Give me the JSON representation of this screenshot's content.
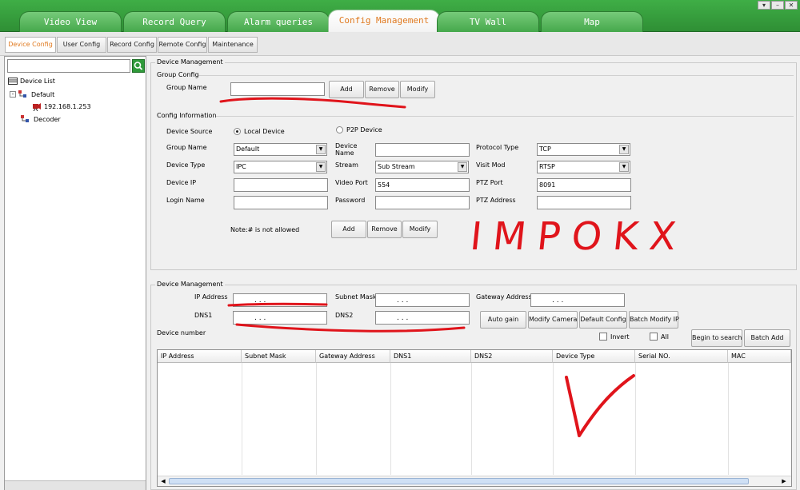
{
  "top_tabs": [
    "Video View",
    "Record Query",
    "Alarm queries",
    "Config Management",
    "TV Wall",
    "Map"
  ],
  "window_controls": [
    "▾",
    "–",
    "✕"
  ],
  "sub_tabs": [
    "Device Config",
    "User Config",
    "Record Config",
    "Remote Config",
    "Maintenance"
  ],
  "left": {
    "search_placeholder": "",
    "tree": {
      "root": "Device List",
      "group": "Default",
      "device": "192.168.1.253",
      "decoder": "Decoder"
    }
  },
  "device_management_1": {
    "title": "Device Management",
    "group_config": {
      "title": "Group Config",
      "group_name_label": "Group Name",
      "group_name_value": "",
      "add": "Add",
      "remove": "Remove",
      "modify": "Modify"
    },
    "config_info": {
      "title": "Config Information",
      "device_source_label": "Device Source",
      "local_device": "Local Device",
      "p2p_device": "P2P Device",
      "group_name_label": "Group Name",
      "group_name_value": "Default",
      "device_name_label": "Device Name",
      "device_name_value": "",
      "protocol_type_label": "Protocol Type",
      "protocol_type_value": "TCP",
      "device_type_label": "Device Type",
      "device_type_value": "IPC",
      "stream_label": "Stream",
      "stream_value": "Sub Stream",
      "visit_mod_label": "Visit Mod",
      "visit_mod_value": "RTSP",
      "device_ip_label": "Device IP",
      "device_ip_value": "",
      "video_port_label": "Video Port",
      "video_port_value": "554",
      "ptz_port_label": "PTZ Port",
      "ptz_port_value": "8091",
      "login_name_label": "Login Name",
      "login_name_value": "",
      "password_label": "Password",
      "password_value": "",
      "ptz_address_label": "PTZ Address",
      "ptz_address_value": "",
      "note": "Note:# is not allowed",
      "add": "Add",
      "remove": "Remove",
      "modify": "Modify"
    }
  },
  "device_management_2": {
    "title": "Device Management",
    "ip_address_label": "IP Address",
    "subnet_mask_label": "Subnet Mask",
    "gateway_address_label": "Gateway Address",
    "dns1_label": "DNS1",
    "dns2_label": "DNS2",
    "ip_dots": ".      .      .",
    "device_number_label": "Device number",
    "auto_gain": "Auto gain",
    "modify_camera": "Modify Camera",
    "default_config": "Default Config",
    "batch_modify_ip": "Batch Modify IP",
    "invert": "Invert",
    "all": "All",
    "begin_to_search": "Begin to search",
    "batch_add": "Batch Add",
    "columns": [
      "IP Address",
      "Subnet Mask",
      "Gateway Address",
      "DNS1",
      "DNS2",
      "Device Type",
      "Serial NO.",
      "MAC"
    ]
  },
  "annotation": {
    "text": "IMPOKX",
    "color": "#e0141b"
  },
  "colors": {
    "topbar": "#3fae46",
    "active_tab_text": "#e07a20",
    "annotation_red": "#e0141b"
  }
}
